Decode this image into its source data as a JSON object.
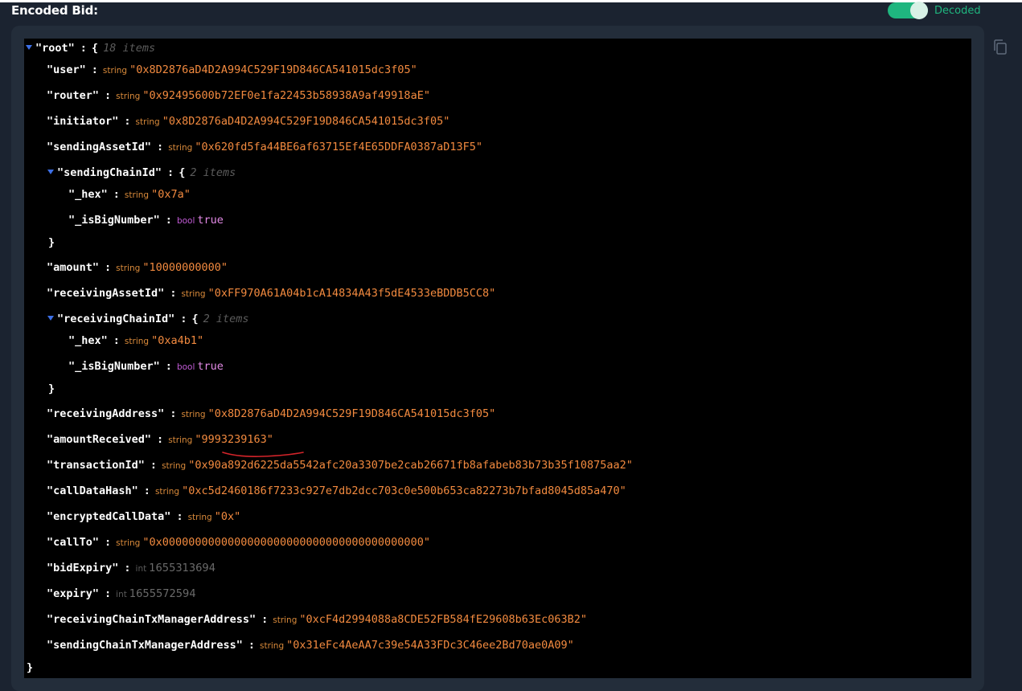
{
  "header": {
    "title": "Encoded Bid:",
    "toggle_label": "Decoded",
    "toggle_on": true
  },
  "colors": {
    "accent": "#1fb67f",
    "string_value": "#f28a3f",
    "bool_value": "#e38ae6",
    "caret": "#3d6fe6",
    "annotation": "#d4242a"
  },
  "json_tree": {
    "root": {
      "key": "\"root\"",
      "count": "18 items"
    },
    "user": {
      "key": "\"user\"",
      "type": "string",
      "value": "\"0x8D2876aD4D2A994C529F19D846CA541015dc3f05\""
    },
    "router": {
      "key": "\"router\"",
      "type": "string",
      "value": "\"0x92495600b72EF0e1fa22453b58938A9af49918aE\""
    },
    "initiator": {
      "key": "\"initiator\"",
      "type": "string",
      "value": "\"0x8D2876aD4D2A994C529F19D846CA541015dc3f05\""
    },
    "sendingAssetId": {
      "key": "\"sendingAssetId\"",
      "type": "string",
      "value": "\"0x620fd5fa44BE6af63715Ef4E65DDFA0387aD13F5\""
    },
    "sendingChainId": {
      "key": "\"sendingChainId\"",
      "count": "2 items",
      "hex": {
        "key": "\"_hex\"",
        "type": "string",
        "value": "\"0x7a\""
      },
      "isBigNumber": {
        "key": "\"_isBigNumber\"",
        "type": "bool",
        "value": "true"
      }
    },
    "amount": {
      "key": "\"amount\"",
      "type": "string",
      "value": "\"10000000000\""
    },
    "receivingAssetId": {
      "key": "\"receivingAssetId\"",
      "type": "string",
      "value": "\"0xFF970A61A04b1cA14834A43f5dE4533eBDDB5CC8\""
    },
    "receivingChainId": {
      "key": "\"receivingChainId\"",
      "count": "2 items",
      "hex": {
        "key": "\"_hex\"",
        "type": "string",
        "value": "\"0xa4b1\""
      },
      "isBigNumber": {
        "key": "\"_isBigNumber\"",
        "type": "bool",
        "value": "true"
      }
    },
    "receivingAddress": {
      "key": "\"receivingAddress\"",
      "type": "string",
      "value": "\"0x8D2876aD4D2A994C529F19D846CA541015dc3f05\""
    },
    "amountReceived": {
      "key": "\"amountReceived\"",
      "type": "string",
      "value": "\"9993239163\""
    },
    "transactionId": {
      "key": "\"transactionId\"",
      "type": "string",
      "value": "\"0x90a892d6225da5542afc20a3307be2cab26671fb8afabeb83b73b35f10875aa2\""
    },
    "callDataHash": {
      "key": "\"callDataHash\"",
      "type": "string",
      "value": "\"0xc5d2460186f7233c927e7db2dcc703c0e500b653ca82273b7bfad8045d85a470\""
    },
    "encryptedCallData": {
      "key": "\"encryptedCallData\"",
      "type": "string",
      "value": "\"0x\""
    },
    "callTo": {
      "key": "\"callTo\"",
      "type": "string",
      "value": "\"0x0000000000000000000000000000000000000000\""
    },
    "bidExpiry": {
      "key": "\"bidExpiry\"",
      "type": "int",
      "value": "1655313694"
    },
    "expiry": {
      "key": "\"expiry\"",
      "type": "int",
      "value": "1655572594"
    },
    "receivingChainTxManagerAddress": {
      "key": "\"receivingChainTxManagerAddress\"",
      "type": "string",
      "value": "\"0xcF4d2994088a8CDE52FB584fE29608b63Ec063B2\""
    },
    "sendingChainTxManagerAddress": {
      "key": "\"sendingChainTxManagerAddress\"",
      "type": "string",
      "value": "\"0x31eFc4AeAA7c39e54A33FDc3C46ee2Bd70ae0A09\""
    }
  },
  "symbols": {
    "open_brace": "{",
    "close_brace": "}",
    "colon": ":"
  }
}
